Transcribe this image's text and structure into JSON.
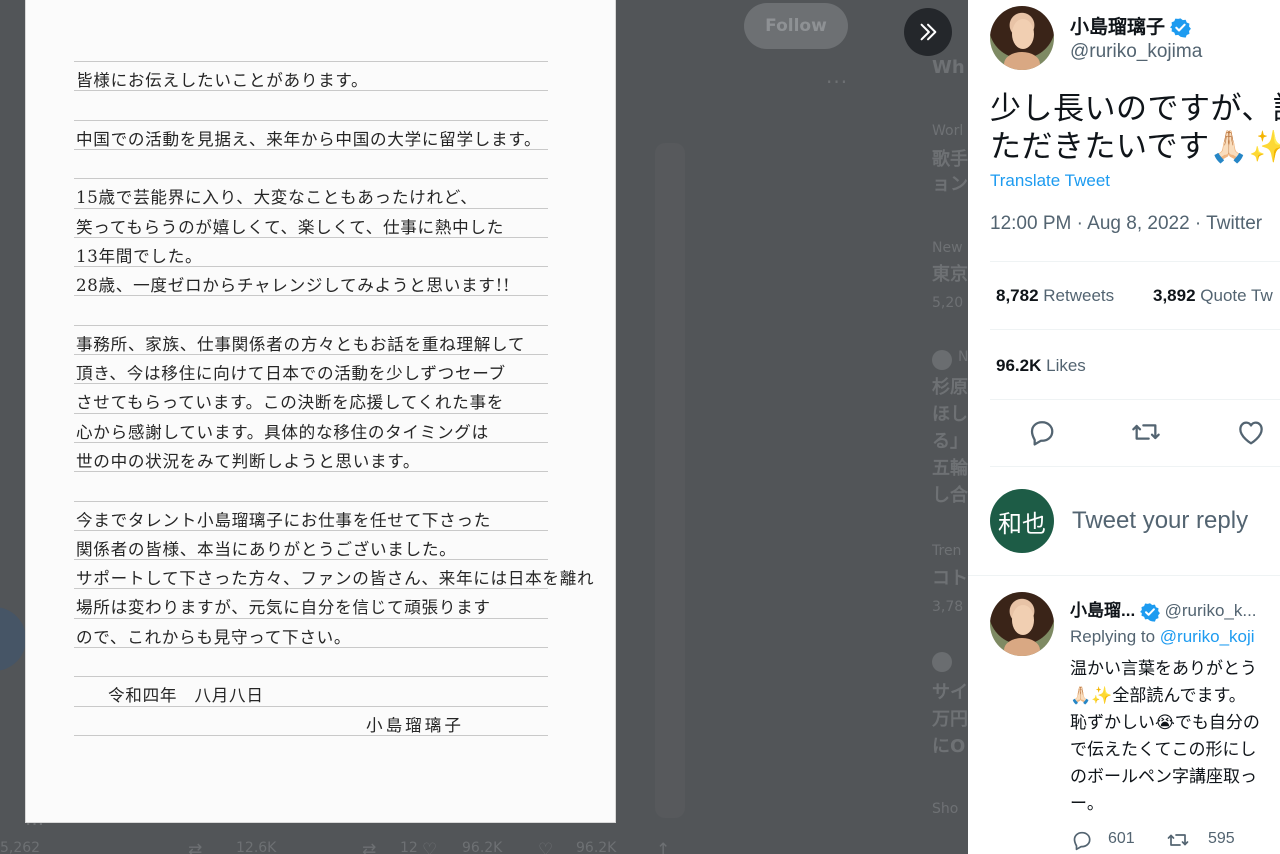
{
  "background": {
    "follow_label": "Follow",
    "more_dots": "···",
    "trends": [
      {
        "text": "Wh",
        "big": true
      },
      {
        "text": "Worl",
        "big": false
      },
      {
        "text": "歌手",
        "big": true
      },
      {
        "text": "ョン",
        "big": true
      },
      {
        "text": "New",
        "big": false
      },
      {
        "text": "東京",
        "big": true
      },
      {
        "text": "5,20",
        "big": false
      },
      {
        "text": "N",
        "big": false
      },
      {
        "text": "杉原",
        "big": true
      },
      {
        "text": "ほし",
        "big": true
      },
      {
        "text": "る」",
        "big": true
      },
      {
        "text": "五輪",
        "big": true
      },
      {
        "text": "し合",
        "big": true
      },
      {
        "text": "Tren",
        "big": false
      },
      {
        "text": "コト",
        "big": true
      },
      {
        "text": "3,78",
        "big": false
      },
      {
        "text": "サイ",
        "big": true
      },
      {
        "text": "万円",
        "big": true
      },
      {
        "text": "にO",
        "big": true
      },
      {
        "text": "Sho",
        "big": false
      }
    ],
    "stats": {
      "replies": "5,262",
      "retweets": "12.6K",
      "quotes": "12",
      "likes": "96.2K",
      "likes2": "96.2K"
    }
  },
  "letter": {
    "lines": [
      "皆様にお伝えしたいことがあります。",
      "",
      "中国での活動を見据え、来年から中国の大学に留学します。",
      "",
      "15歳で芸能界に入り、大変なこともあったけれど、",
      "笑ってもらうのが嬉しくて、楽しくて、仕事に熱中した",
      "13年間でした。",
      "28歳、一度ゼロからチャレンジしてみようと思います!!",
      "",
      "事務所、家族、仕事関係者の方々ともお話を重ね理解して",
      "頂き、今は移住に向けて日本での活動を少しずつセーブ",
      "させてもらっています。この決断を応援してくれた事を",
      "心から感謝しています。具体的な移住のタイミングは",
      "世の中の状況をみて判断しようと思います。",
      "",
      "今までタレント小島瑠璃子にお仕事を任せて下さった",
      "関係者の皆様、本当にありがとうございました。",
      "サポートして下さった方々、ファンの皆さん、来年には日本を離れ",
      "場所は変わりますが、元気に自分を信じて頑張ります",
      "ので、これからも見守って下さい。",
      "",
      "令和四年　八月八日",
      "小島瑠璃子"
    ]
  },
  "tweet": {
    "author_name": "小島瑠璃子",
    "author_handle": "@ruriko_kojima",
    "text_line1": "少し長いのですが、読",
    "text_line2": "ただきたいです🙏🏻✨",
    "translate_label": "Translate Tweet",
    "timestamp": "12:00 PM · Aug 8, 2022 · Twitter",
    "retweets_count": "8,782",
    "retweets_label": "Retweets",
    "quotes_count": "3,892",
    "quotes_label": "Quote Tw",
    "likes_count": "96.2K",
    "likes_label": "Likes"
  },
  "compose": {
    "avatar_text": "和也",
    "placeholder": "Tweet your reply"
  },
  "reply": {
    "author_name": "小島瑠...",
    "author_handle": "@ruriko_k...",
    "replying_prefix": "Replying to",
    "replying_handle": "@ruriko_koji",
    "lines": [
      "温かい言葉をありがとう",
      "🙏🏻✨全部読んでます。",
      "恥ずかしい😭でも自分の",
      "で伝えたくてこの形にし",
      "のボールペン字講座取っ",
      "ー。"
    ],
    "reply_count": "601",
    "retweet_count": "595"
  },
  "colors": {
    "accent": "#1d9bf0",
    "text": "#0f1419",
    "muted": "#536471",
    "overlay": "#525558"
  }
}
